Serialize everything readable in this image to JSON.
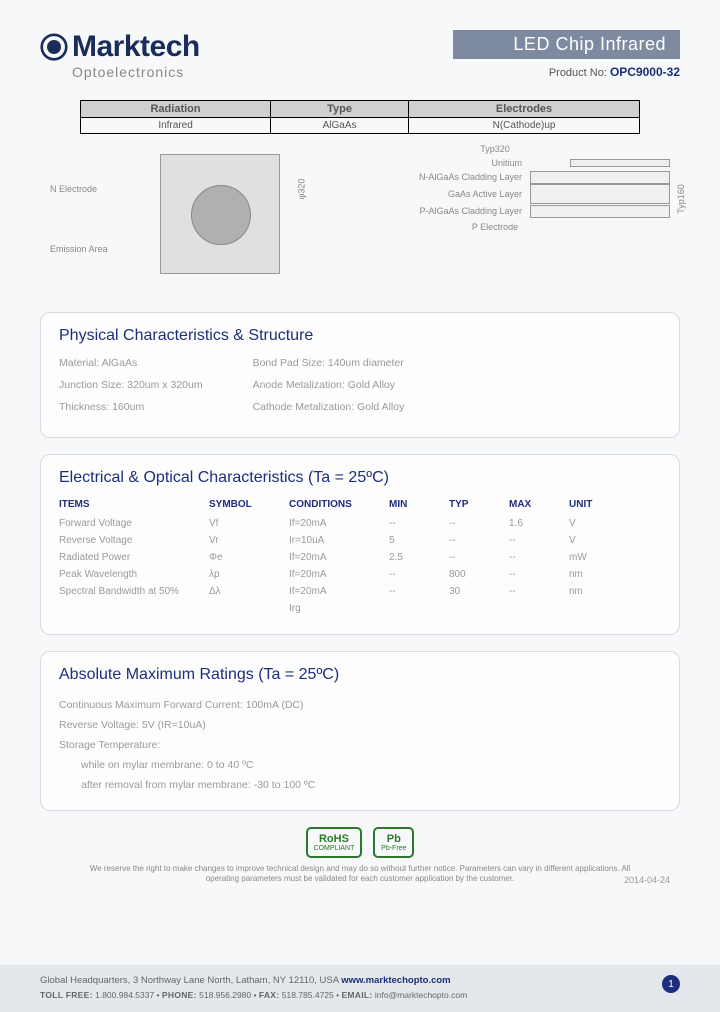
{
  "header": {
    "brand_main": "Marktech",
    "brand_sub": "Optoelectronics",
    "title_band": "LED Chip Infrared",
    "product_label": "Product No: ",
    "product_no": "OPC9000-32"
  },
  "class_table": {
    "headers": [
      "Radiation",
      "Type",
      "Electrodes"
    ],
    "row": [
      "Infrared",
      "AlGaAs",
      "N(Cathode)up"
    ]
  },
  "diagram": {
    "n_electrode": "N Electrode",
    "emission_area": "Emission Area",
    "dim_320": "φ320",
    "top_dim": "Typ320",
    "side_dim": "Typ160",
    "layers": [
      "Unitium",
      "N-AlGaAs Cladding Layer",
      "GaAs Active Layer",
      "P-AlGaAs Cladding Layer"
    ],
    "p_electrode": "P Electrode"
  },
  "physical": {
    "title": "Physical Characteristics & Structure",
    "left": [
      "Material: AlGaAs",
      "Junction Size: 320um x 320um",
      "Thickness: 160um"
    ],
    "right": [
      "Bond Pad Size: 140um diameter",
      "Anode Metalization: Gold Alloy",
      "Cathode Metalization: Gold Alloy"
    ]
  },
  "electrical": {
    "title": "Electrical & Optical Characteristics (Ta = 25ºC)",
    "headers": {
      "items": "ITEMS",
      "symbol": "SYMBOL",
      "conditions": "CONDITIONS",
      "min": "MIN",
      "typ": "TYP",
      "max": "MAX",
      "unit": "UNIT"
    },
    "rows": [
      {
        "item": "Forward Voltage",
        "sym": "Vf",
        "cond": "If=20mA",
        "min": "--",
        "typ": "--",
        "max": "1.6",
        "unit": "V"
      },
      {
        "item": "Reverse Voltage",
        "sym": "Vr",
        "cond": "Ir=10uA",
        "min": "5",
        "typ": "--",
        "max": "--",
        "unit": "V"
      },
      {
        "item": "Radiated Power",
        "sym": "Φe",
        "cond": "If=20mA",
        "min": "2.5",
        "typ": "--",
        "max": "--",
        "unit": "mW"
      },
      {
        "item": "Peak Wavelength",
        "sym": "λp",
        "cond": "If=20mA",
        "min": "--",
        "typ": "800",
        "max": "--",
        "unit": "nm"
      },
      {
        "item": "Spectral Bandwidth at 50%",
        "sym": "Δλ",
        "cond": "If=20mA",
        "min": "--",
        "typ": "30",
        "max": "--",
        "unit": "nm"
      }
    ],
    "trailing": "Irg"
  },
  "absolute": {
    "title": "Absolute Maximum Ratings (Ta = 25ºC)",
    "lines": [
      "Continuous Maximum Forward Current: 100mA (DC)",
      "Reverse Voltage: 5V (IR=10uA)",
      "Storage Temperature:"
    ],
    "indented": [
      "while on mylar membrane: 0 to 40 ºC",
      "after removal from mylar membrane: -30 to 100 ºC"
    ]
  },
  "badges": {
    "rohs_main": "RoHS",
    "rohs_sub": "COMPLIANT",
    "pb_main": "Pb",
    "pb_sub": "Pb-Free"
  },
  "disclaimer": "We reserve the right to make changes to improve technical design and may do so without further notice. Parameters can vary in different applications. All operating parameters must be validated for each customer application by the customer.",
  "doc_date": "2014-04-24",
  "footer": {
    "line1_pre": "Global Headquarters, 3 Northway Lane North, Latham, NY 12110, USA   ",
    "link": "www.marktechopto.com",
    "tollfree_label": "TOLL FREE:",
    "tollfree": " 1.800.984.5337 • ",
    "phone_label": "PHONE:",
    "phone": " 518.956.2980 • ",
    "fax_label": "FAX:",
    "fax": " 518.785.4725 • ",
    "email_label": "EMAIL:",
    "email": " info@marktechopto.com",
    "page": "1"
  }
}
